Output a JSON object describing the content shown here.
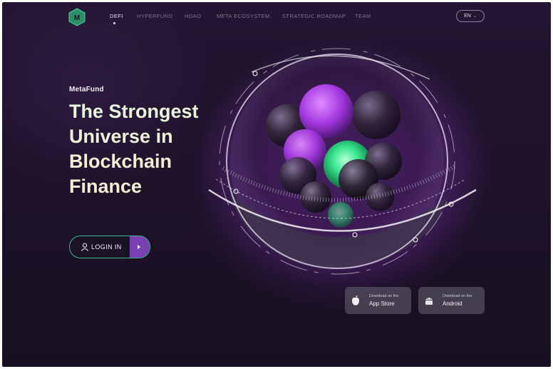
{
  "nav": {
    "items": [
      {
        "label": "DEFI",
        "active": true
      },
      {
        "label": "HYPERFUND",
        "active": false
      },
      {
        "label": "HDAO",
        "active": false
      },
      {
        "label": "META ECOSYSTEM",
        "active": false
      },
      {
        "label": "STRATEGIC ROADMAP",
        "active": false
      },
      {
        "label": "TEAM",
        "active": false
      }
    ],
    "logo_letter": "M",
    "language": "EN"
  },
  "hero": {
    "brand": "MetaFund",
    "headline": [
      "The Strongest",
      "Universe in",
      "Blockchain",
      "Finance"
    ],
    "login_label": "LOGIN IN"
  },
  "stores": {
    "apple": {
      "caption": "Download on the",
      "name": "App Store"
    },
    "android": {
      "caption": "Download on the",
      "name": "Android"
    }
  },
  "colors": {
    "background": "#1e1229",
    "accent_green": "#3fb38c",
    "accent_purple": "#7a3fb0"
  },
  "icons": [
    "logo-icon",
    "chevron-down-icon",
    "user-icon",
    "play-arrow-icon",
    "apple-icon",
    "android-icon"
  ]
}
